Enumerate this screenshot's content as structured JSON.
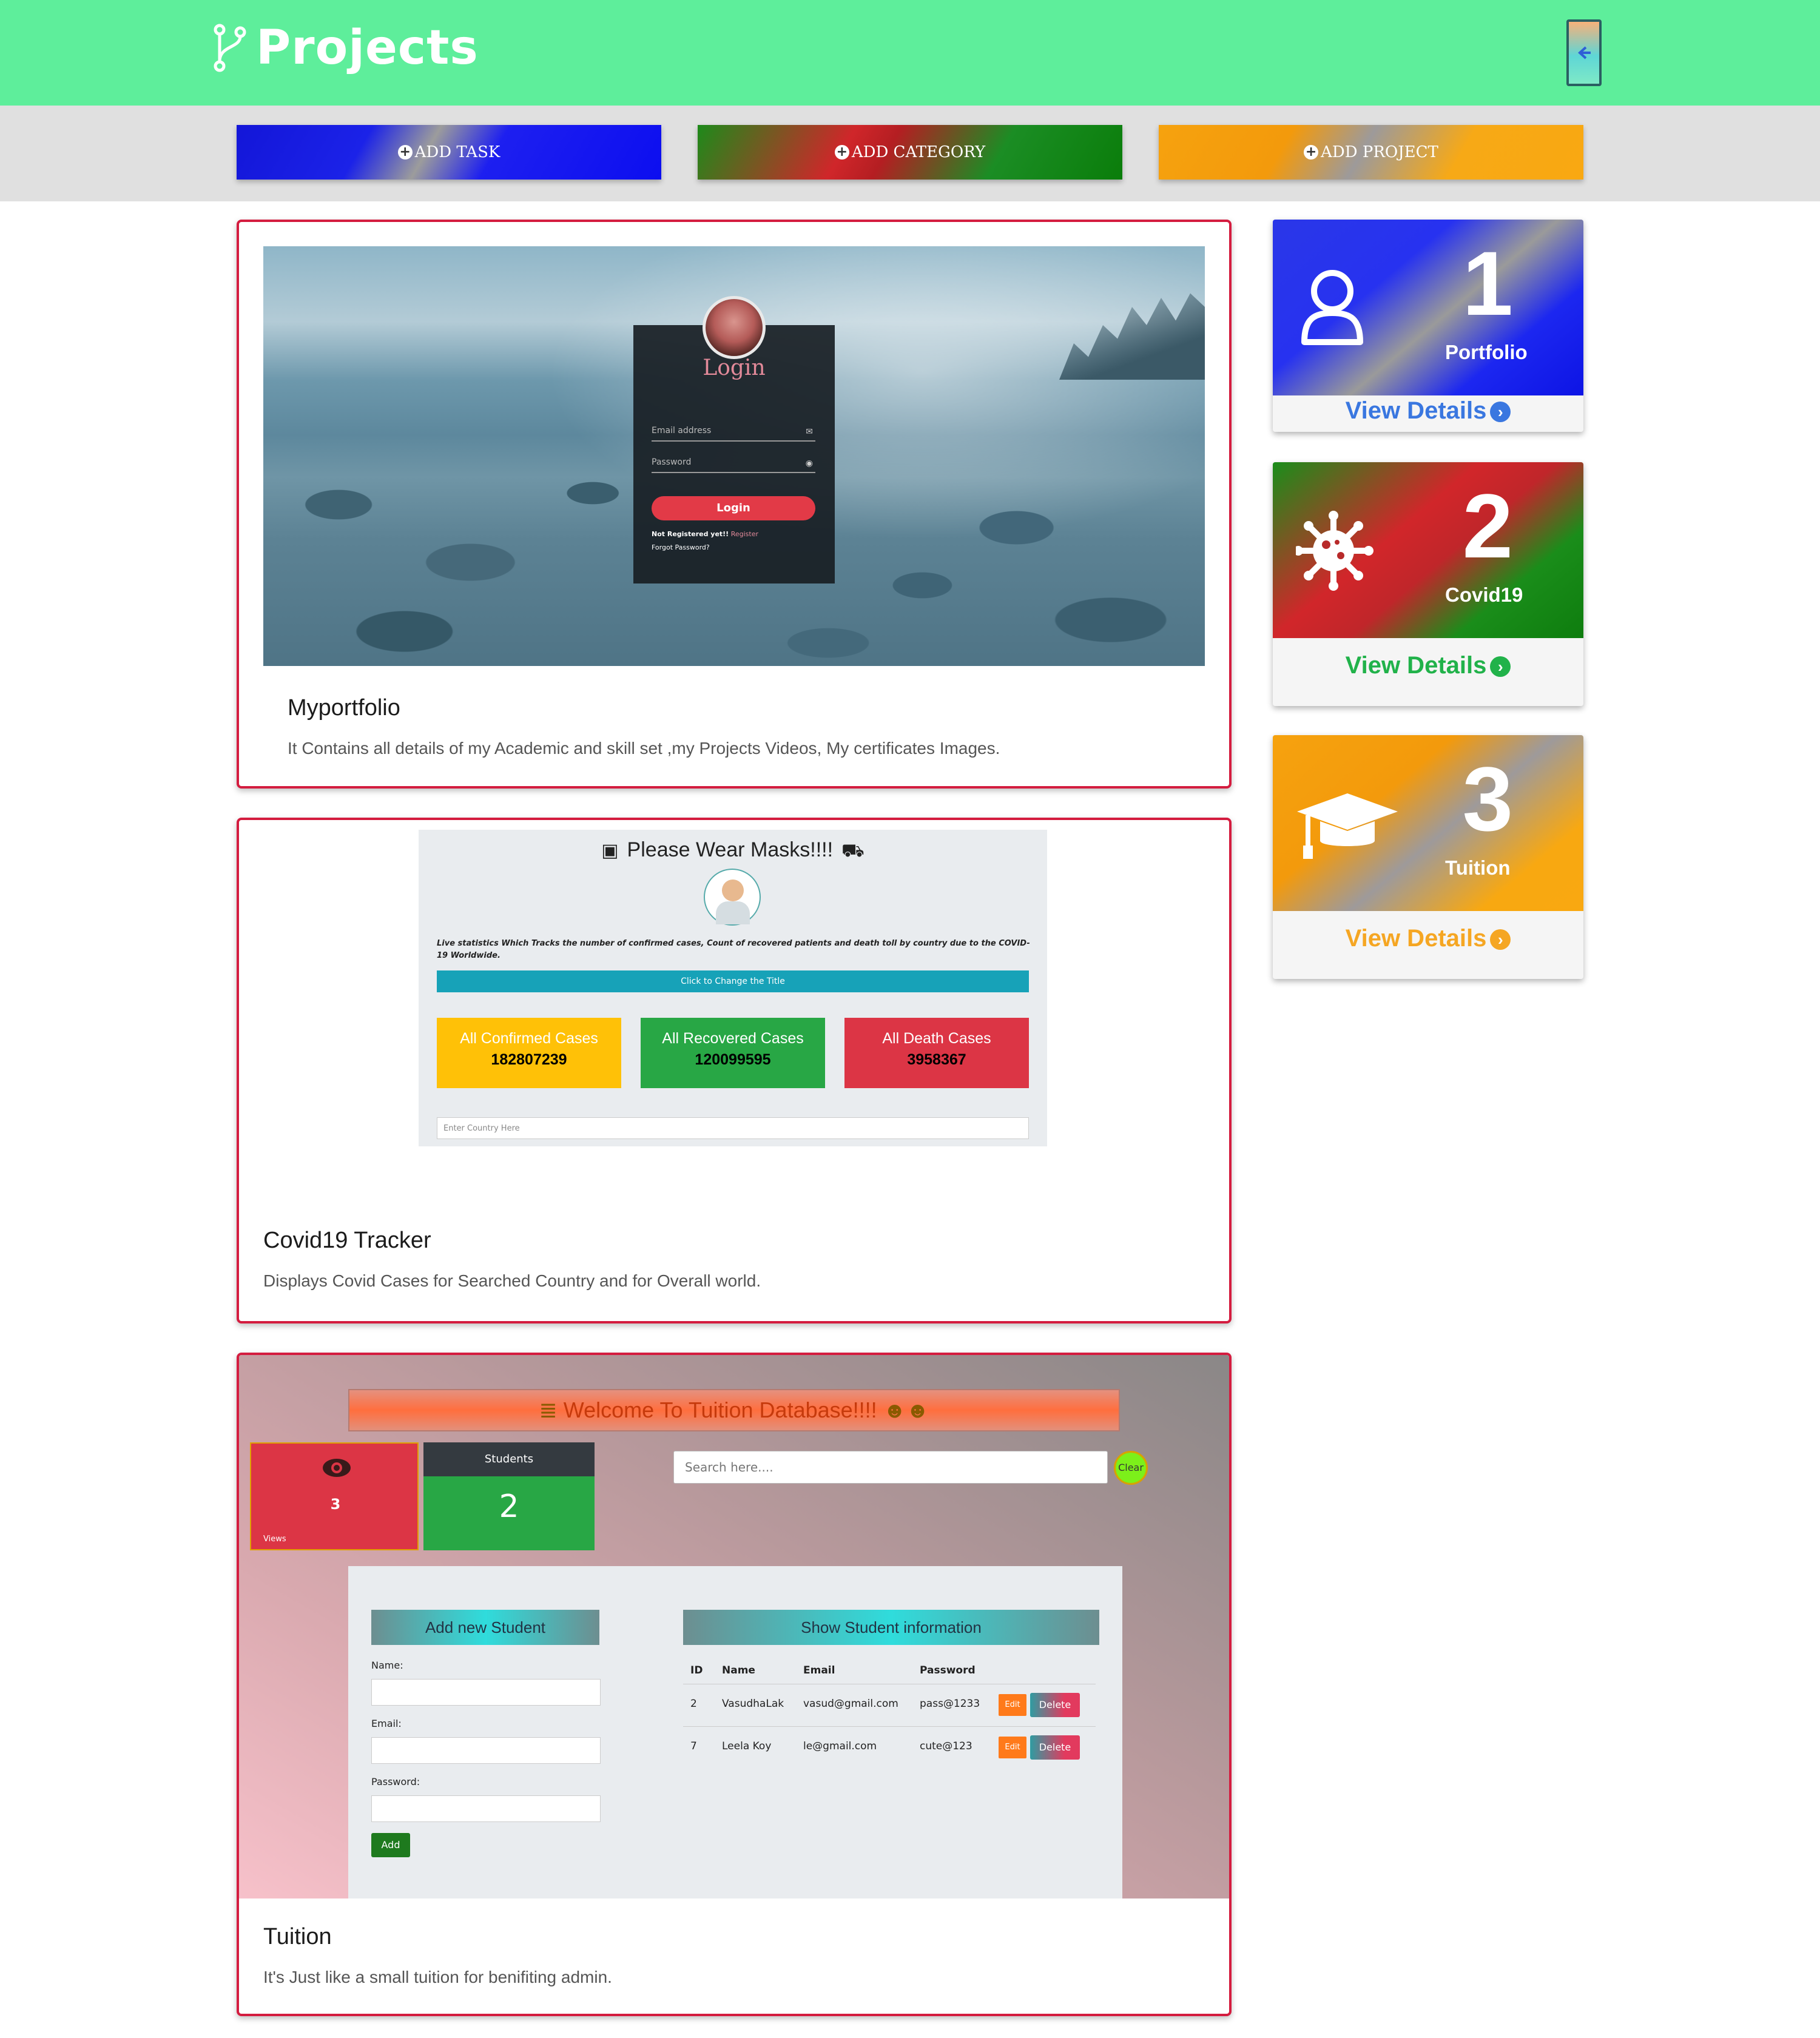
{
  "header": {
    "title": "Projects",
    "brand_icon": "code-branch-icon",
    "back_icon": "arrow-left-icon"
  },
  "actions": [
    {
      "label": "ADD TASK",
      "icon": "plus-circle-icon",
      "color": "#1316d8"
    },
    {
      "label": "ADD CATEGORY",
      "icon": "plus-circle-icon",
      "color": "#d0262a"
    },
    {
      "label": "ADD PROJECT",
      "icon": "plus-circle-icon",
      "color": "#f6a20e"
    }
  ],
  "projects": [
    {
      "title": "Myportfolio",
      "description": "It Contains all details of my Academic and skill set ,my Projects Videos, My certificates Images.",
      "preview": {
        "heading": "Login",
        "email_placeholder": "Email address",
        "password_placeholder": "Password",
        "button": "Login",
        "note_prefix": "Not Registered yet!!",
        "note_link": "Register",
        "forgot": "Forgot Password?"
      }
    },
    {
      "title": "Covid19 Tracker",
      "description": "Displays Covid Cases for Searched Country and for Overall world.",
      "preview": {
        "heading": "Please Wear Masks!!!!",
        "text": "Live statistics Which Tracks the number of confirmed cases, Count of recovered patients and death toll by country due to the COVID-19 Worldwide.",
        "bar": "Click to Change the Title",
        "stats": [
          {
            "label": "All Confirmed Cases",
            "value": "182807239",
            "color": "#ffc107"
          },
          {
            "label": "All Recovered Cases",
            "value": "120099595",
            "color": "#28a745"
          },
          {
            "label": "All Death Cases",
            "value": "3958367",
            "color": "#dc3545"
          }
        ],
        "country_placeholder": "Enter Country Here"
      }
    },
    {
      "title": "Tuition",
      "description": "It's Just like a small tuition for benifiting admin.",
      "preview": {
        "banner": "Welcome To Tuition Database!!!!",
        "views_count": "3",
        "views_label": "Views",
        "students_label": "Students",
        "students_count": "2",
        "search_placeholder": "Search here....",
        "clear": "Clear",
        "add_title": "Add new Student",
        "name_label": "Name:",
        "email_label": "Email:",
        "password_label": "Password:",
        "add_button": "Add",
        "show_title": "Show Student information",
        "columns": [
          "ID",
          "Name",
          "Email",
          "Password"
        ],
        "rows": [
          {
            "id": "2",
            "name": "VasudhaLak",
            "email": "vasud@gmail.com",
            "password": "pass@1233"
          },
          {
            "id": "7",
            "name": "Leela Koy",
            "email": "le@gmail.com",
            "password": "cute@123"
          }
        ],
        "edit": "Edit",
        "delete": "Delete"
      }
    }
  ],
  "categories": [
    {
      "number": "1",
      "label": "Portfolio",
      "link": "View Details",
      "icon": "user-icon",
      "link_color": "#3a77e0"
    },
    {
      "number": "2",
      "label": "Covid19",
      "link": "View Details",
      "icon": "virus-icon",
      "link_color": "#21b24a"
    },
    {
      "number": "3",
      "label": "Tuition",
      "link": "View Details",
      "icon": "graduation-cap-icon",
      "link_color": "#f5a623"
    }
  ]
}
